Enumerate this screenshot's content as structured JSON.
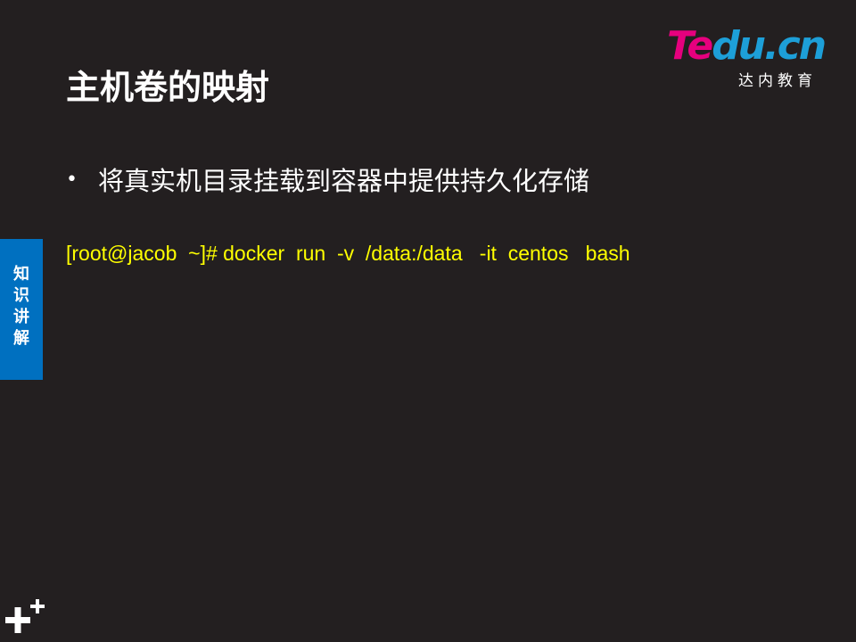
{
  "logo": {
    "text_part1": "Te",
    "text_part2": "du.cn",
    "subtitle": "达内教育",
    "colors": {
      "primary": "#e6007e",
      "secondary": "#1d9fd8"
    }
  },
  "slide": {
    "title": "主机卷的映射",
    "bullets": [
      {
        "symbol": "•",
        "text": "将真实机目录挂载到容器中提供持久化存储"
      }
    ],
    "command": "[root@jacob  ~]# docker  run  -v  /data:/data   -it  centos   bash",
    "side_tab": {
      "label": "知\n识\n讲\n解",
      "color": "#0070c0"
    },
    "corner_icon": "plus-plus-icon",
    "colors": {
      "background": "#231f20",
      "command_text": "#ffff00"
    }
  }
}
